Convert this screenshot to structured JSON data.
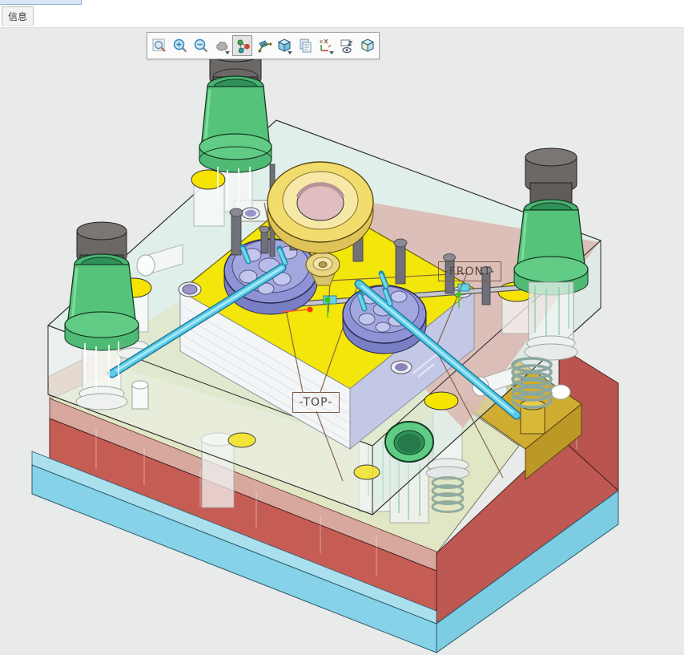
{
  "window": {
    "tab_label": "信息"
  },
  "toolbar": {
    "selected_tool": "orbit",
    "buttons": [
      {
        "id": "zoom-region",
        "icon": "zoom-region-icon",
        "selected": false,
        "has_dropdown": false
      },
      {
        "id": "zoom-in",
        "icon": "zoom-in-icon",
        "selected": false,
        "has_dropdown": false
      },
      {
        "id": "zoom-out",
        "icon": "zoom-out-icon",
        "selected": false,
        "has_dropdown": false
      },
      {
        "id": "pan",
        "icon": "pan-icon",
        "selected": false,
        "has_dropdown": true
      },
      {
        "id": "orbit",
        "icon": "orbit-icon",
        "selected": true,
        "has_dropdown": false
      },
      {
        "id": "reorient",
        "icon": "reorient-icon",
        "selected": false,
        "has_dropdown": false
      },
      {
        "id": "named-views",
        "icon": "named-views-cube-icon",
        "selected": false,
        "has_dropdown": true
      },
      {
        "id": "copy-view",
        "icon": "copy-view-icon",
        "selected": false,
        "has_dropdown": false
      },
      {
        "id": "datum-display",
        "icon": "datum-display-icon",
        "selected": false,
        "has_dropdown": true
      },
      {
        "id": "annotation-display",
        "icon": "annotation-display-icon",
        "selected": false,
        "has_dropdown": false
      },
      {
        "id": "display-style",
        "icon": "display-style-cube-icon",
        "selected": false,
        "has_dropdown": false
      }
    ]
  },
  "viewport": {
    "datum_labels": {
      "front": "-FRONT-",
      "top": "-TOP-"
    },
    "colors": {
      "viewport_bg": "#e9eaea",
      "glass_plate": "#dfeee8",
      "pink_plate": "#dcb9b4",
      "ejector_plate_red": "#c25048",
      "base_plate_blue": "#8fd5e8",
      "core_plate_yellow": "#f2e60a",
      "insert_purple": "#9497d6",
      "guide_bushing_green": "#55c47a",
      "locating_ring_yellow": "#f0dc74",
      "angle_pin_cyan": "#5acce8",
      "support_gold": "#d0ac30"
    }
  }
}
